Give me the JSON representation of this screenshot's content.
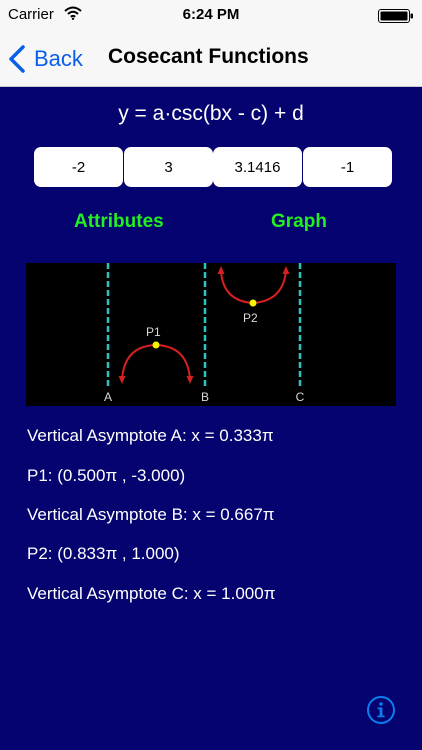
{
  "status_bar": {
    "carrier": "Carrier",
    "time": "6:24 PM"
  },
  "nav": {
    "back_label": "Back",
    "title": "Cosecant Functions"
  },
  "formula": "y = a·csc(bx - c) + d",
  "params": [
    {
      "value": "-2"
    },
    {
      "value": "3"
    },
    {
      "value": "3.1416"
    },
    {
      "value": "-1"
    }
  ],
  "tabs": {
    "attributes": "Attributes",
    "graph": "Graph"
  },
  "graph": {
    "asymptote_labels": [
      "A",
      "B",
      "C"
    ],
    "point_labels": [
      "P1",
      "P2"
    ],
    "colors": {
      "background": "#000000",
      "asymptote": "#2cc3c3",
      "curve": "#d42020",
      "point": "#f5f500",
      "label": "#d8d8d8"
    }
  },
  "attributes": [
    "Vertical Asymptote A: x = 0.333π",
    "P1: (0.500π , -3.000)",
    "Vertical Asymptote B: x = 0.667π",
    "P2: (0.833π , 1.000)",
    "Vertical Asymptote C: x = 1.000π"
  ],
  "colors": {
    "background": "#05036f",
    "tab_text": "#22ee22",
    "bar_background": "#f7f7f7",
    "accent": "#0a5ee8"
  },
  "icons": {
    "wifi": "wifi-icon",
    "battery": "battery-icon",
    "back": "chevron-left-icon",
    "info": "info-icon"
  }
}
